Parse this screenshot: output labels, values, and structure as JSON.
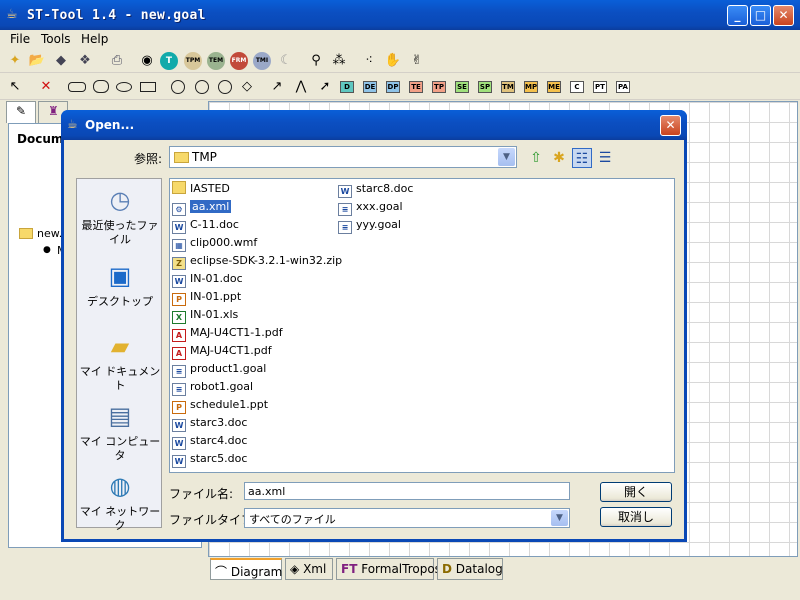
{
  "app": {
    "title": "ST-Tool 1.4 - new.goal"
  },
  "menu": {
    "items": [
      "File",
      "Tools",
      "Help"
    ]
  },
  "toolbar1": {
    "tags": [
      "T",
      "TPM",
      "TEM",
      "FRM",
      "TMI"
    ]
  },
  "toolbar2": {
    "tags": [
      "D",
      "DE",
      "DP",
      "TE",
      "TP",
      "SE",
      "SP",
      "TM",
      "MP",
      "ME",
      "C",
      "PT",
      "PA"
    ]
  },
  "left_panel": {
    "label": "Docume",
    "tree_root": "new.g",
    "tree_child": "M"
  },
  "bottom_tabs": [
    {
      "label": "Diagram"
    },
    {
      "label": "Xml"
    },
    {
      "label": "FormalTropos"
    },
    {
      "label": "Datalog"
    }
  ],
  "dialog": {
    "title": "Open...",
    "look_in_label": "参照:",
    "look_in_value": "TMP",
    "places": [
      {
        "label": "最近使ったファイル",
        "icon": "recent-icon"
      },
      {
        "label": "デスクトップ",
        "icon": "desktop-icon"
      },
      {
        "label": "マイ ドキュメント",
        "icon": "my-documents-icon"
      },
      {
        "label": "マイ コンピュータ",
        "icon": "my-computer-icon"
      },
      {
        "label": "マイ ネットワーク",
        "icon": "my-network-icon"
      }
    ],
    "files_col1": [
      {
        "name": "IASTED",
        "type": "folder"
      },
      {
        "name": "aa.xml",
        "type": "xml",
        "selected": true
      },
      {
        "name": "C-11.doc",
        "type": "doc"
      },
      {
        "name": "clip000.wmf",
        "type": "wmf"
      },
      {
        "name": "eclipse-SDK-3.2.1-win32.zip",
        "type": "zip"
      },
      {
        "name": "IN-01.doc",
        "type": "doc"
      },
      {
        "name": "IN-01.ppt",
        "type": "ppt"
      },
      {
        "name": "IN-01.xls",
        "type": "xls"
      },
      {
        "name": "MAJ-U4CT1-1.pdf",
        "type": "pdf"
      },
      {
        "name": "MAJ-U4CT1.pdf",
        "type": "pdf"
      },
      {
        "name": "product1.goal",
        "type": "goal"
      },
      {
        "name": "robot1.goal",
        "type": "goal"
      },
      {
        "name": "schedule1.ppt",
        "type": "ppt"
      },
      {
        "name": "starc3.doc",
        "type": "doc"
      },
      {
        "name": "starc4.doc",
        "type": "doc"
      },
      {
        "name": "starc5.doc",
        "type": "doc"
      }
    ],
    "files_col2": [
      {
        "name": "starc8.doc",
        "type": "doc"
      },
      {
        "name": "xxx.goal",
        "type": "goal"
      },
      {
        "name": "yyy.goal",
        "type": "goal"
      }
    ],
    "filename_label": "ファイル名:",
    "filename_value": "aa.xml",
    "filetype_label": "ファイルタイプ:",
    "filetype_value": "すべてのファイル",
    "open_button": "開く",
    "cancel_button": "取消し"
  }
}
